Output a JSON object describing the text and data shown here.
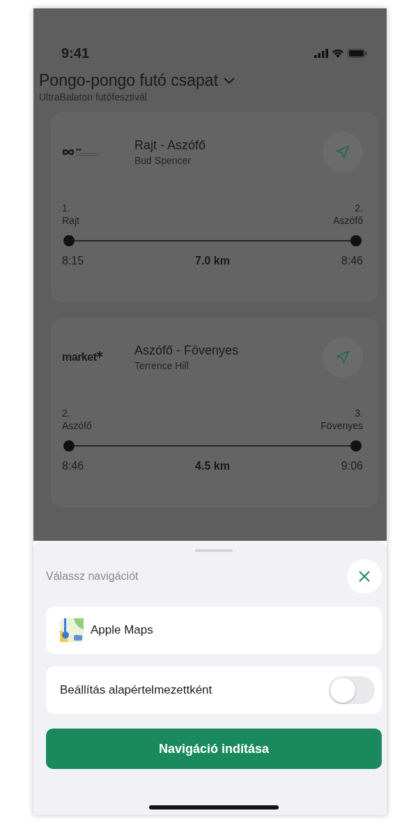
{
  "status_bar": {
    "time": "9:41"
  },
  "header": {
    "title": "Pongo-pongo futó csapat",
    "subtitle": "UltraBalaton futófesztivál"
  },
  "legs": [
    {
      "logo": {
        "kind": "infinity"
      },
      "title": "Rajt - Aszófő",
      "runner": "Bud Spencer",
      "from": {
        "number": "1.",
        "name": "Rajt",
        "time": "8:15"
      },
      "to": {
        "number": "2.",
        "name": "Aszófő",
        "time": "8:46"
      },
      "distance": "7.0 km"
    },
    {
      "logo": {
        "kind": "wordmark",
        "text": "market"
      },
      "title": "Aszófő - Fövenyes",
      "runner": "Terrence Hill",
      "from": {
        "number": "2.",
        "name": "Aszófő",
        "time": "8:46"
      },
      "to": {
        "number": "3.",
        "name": "Fövenyes",
        "time": "9:06"
      },
      "distance": "4.5 km"
    }
  ],
  "sheet": {
    "title": "Válassz navigációt",
    "app": {
      "name": "Apple Maps"
    },
    "default_toggle": {
      "label": "Beállítás alapértelmezettként",
      "on": false
    },
    "start_button": "Navigáció indítása"
  }
}
